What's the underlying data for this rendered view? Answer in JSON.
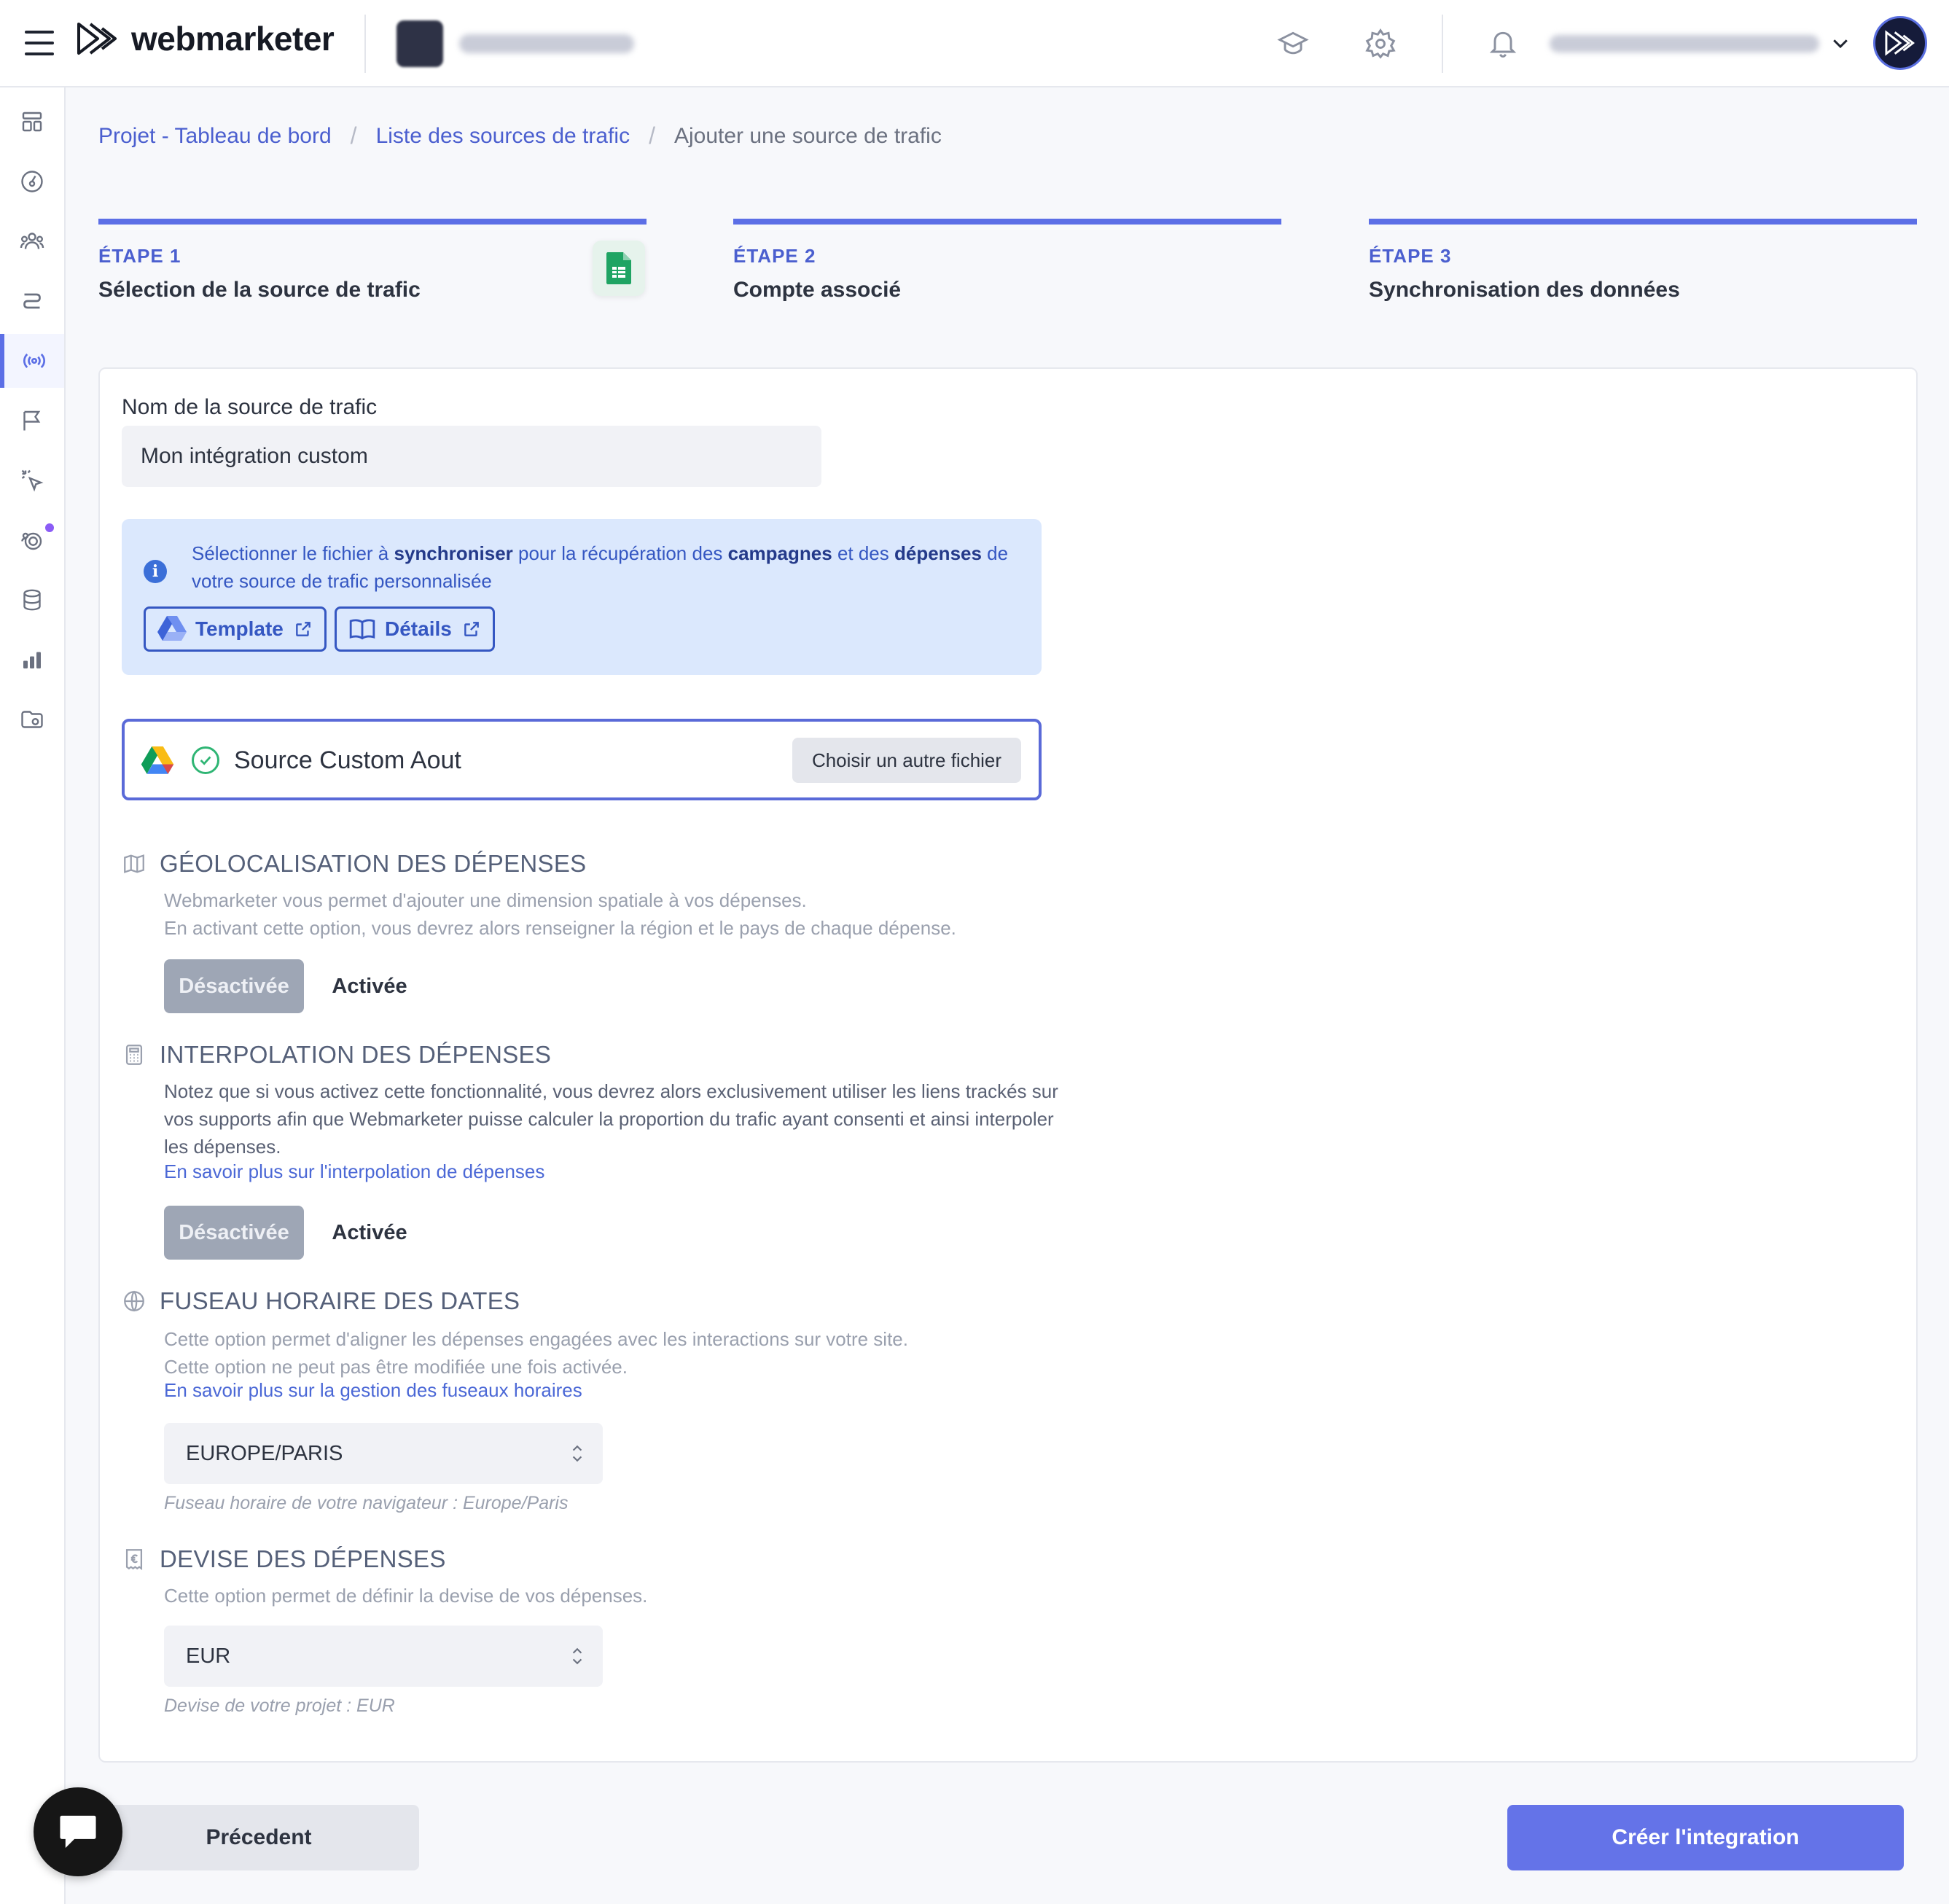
{
  "header": {
    "brand": "webmarketer"
  },
  "breadcrumb": {
    "items": [
      "Projet - Tableau de bord",
      "Liste des sources de trafic"
    ],
    "separator": "/",
    "current": "Ajouter une source de trafic"
  },
  "steps": [
    {
      "number": "ÉTAPE 1",
      "title": "Sélection de la source de trafic"
    },
    {
      "number": "ÉTAPE 2",
      "title": "Compte associé"
    },
    {
      "number": "ÉTAPE 3",
      "title": "Synchronisation des données"
    }
  ],
  "form": {
    "name_label": "Nom de la source de trafic",
    "name_value": "Mon intégration custom",
    "info": {
      "text_1": "Sélectionner le fichier à ",
      "bold_1": "synchroniser",
      "text_2": " pour la récupération des ",
      "bold_2": "campagnes",
      "text_3": " et des ",
      "bold_3": "dépenses",
      "text_4": " de votre source de trafic personnalisée",
      "template_label": "Template",
      "details_label": "Détails"
    },
    "file": {
      "name": "Source Custom Aout",
      "change_label": "Choisir un autre fichier"
    },
    "geo": {
      "title": "GÉOLOCALISATION DES DÉPENSES",
      "desc_1": "Webmarketer vous permet d'ajouter une dimension spatiale à vos dépenses.",
      "desc_2": "En activant cette option, vous devrez alors renseigner la région et le pays de chaque dépense.",
      "off_label": "Désactivée",
      "on_label": "Activée"
    },
    "interp": {
      "title": "INTERPOLATION DES DÉPENSES",
      "desc": "Notez que si vous activez cette fonctionnalité, vous devrez alors exclusivement utiliser les liens trackés sur vos supports afin que Webmarketer puisse calculer la proportion du trafic ayant consenti et ainsi interpoler les dépenses.",
      "link": "En savoir plus sur l'interpolation de dépenses",
      "off_label": "Désactivée",
      "on_label": "Activée"
    },
    "timezone": {
      "title": "FUSEAU HORAIRE DES DATES",
      "desc_1": "Cette option permet d'aligner les dépenses engagées avec les interactions sur votre site.",
      "desc_2": "Cette option ne peut pas être modifiée une fois activée.",
      "link": "En savoir plus sur la gestion des fuseaux horaires",
      "value": "EUROPE/PARIS",
      "hint": "Fuseau horaire de votre navigateur : Europe/Paris"
    },
    "currency": {
      "title": "DEVISE DES DÉPENSES",
      "desc": "Cette option permet de définir la devise de vos dépenses.",
      "value": "EUR",
      "hint": "Devise de votre projet : EUR"
    }
  },
  "footer": {
    "prev_label": "Précedent",
    "create_label": "Créer l'integration"
  },
  "colors": {
    "accent": "#5c6fe6",
    "primary_button": "#6473e8",
    "info_bg": "#dbe8fd",
    "success": "#2fb574"
  },
  "icons": {
    "sidebar": [
      "dashboard-icon",
      "speedometer-icon",
      "users-icon",
      "route-icon",
      "broadcast-icon",
      "flag-icon",
      "cursor-click-icon",
      "target-icon",
      "database-icon",
      "bar-chart-icon",
      "folder-icon"
    ],
    "top": [
      "graduation-cap-icon",
      "gear-icon",
      "bell-icon"
    ]
  }
}
